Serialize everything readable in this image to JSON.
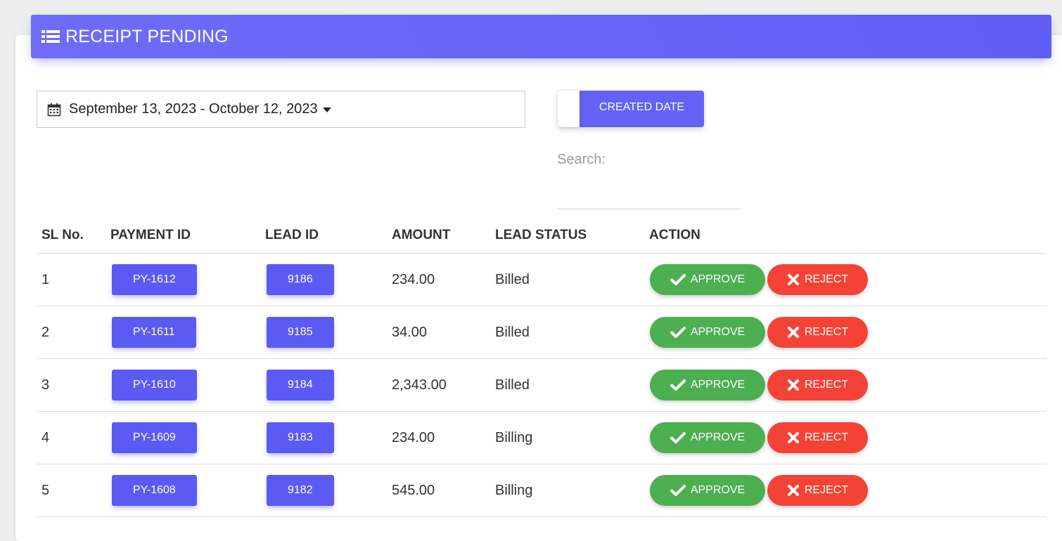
{
  "header": {
    "title": "RECEIPT PENDING",
    "icon": "list-icon"
  },
  "filters": {
    "date_range": "September 13, 2023 - October 12, 2023",
    "toggle_label": "CREATED DATE",
    "search_label": "Search:",
    "search_value": ""
  },
  "table": {
    "columns": [
      "SL No.",
      "PAYMENT ID",
      "LEAD ID",
      "AMOUNT",
      "LEAD STATUS",
      "ACTION"
    ],
    "approve_label": "APPROVE",
    "reject_label": "REJECT",
    "rows": [
      {
        "sl": "1",
        "payment_id": "PY-1612",
        "lead_id": "9186",
        "amount": "234.00",
        "status": "Billed"
      },
      {
        "sl": "2",
        "payment_id": "PY-1611",
        "lead_id": "9185",
        "amount": "34.00",
        "status": "Billed"
      },
      {
        "sl": "3",
        "payment_id": "PY-1610",
        "lead_id": "9184",
        "amount": "2,343.00",
        "status": "Billed"
      },
      {
        "sl": "4",
        "payment_id": "PY-1609",
        "lead_id": "9183",
        "amount": "234.00",
        "status": "Billing"
      },
      {
        "sl": "5",
        "payment_id": "PY-1608",
        "lead_id": "9182",
        "amount": "545.00",
        "status": "Billing"
      }
    ]
  },
  "colors": {
    "primary": "#5b5af4",
    "approve": "#4caf50",
    "reject": "#f44336"
  }
}
